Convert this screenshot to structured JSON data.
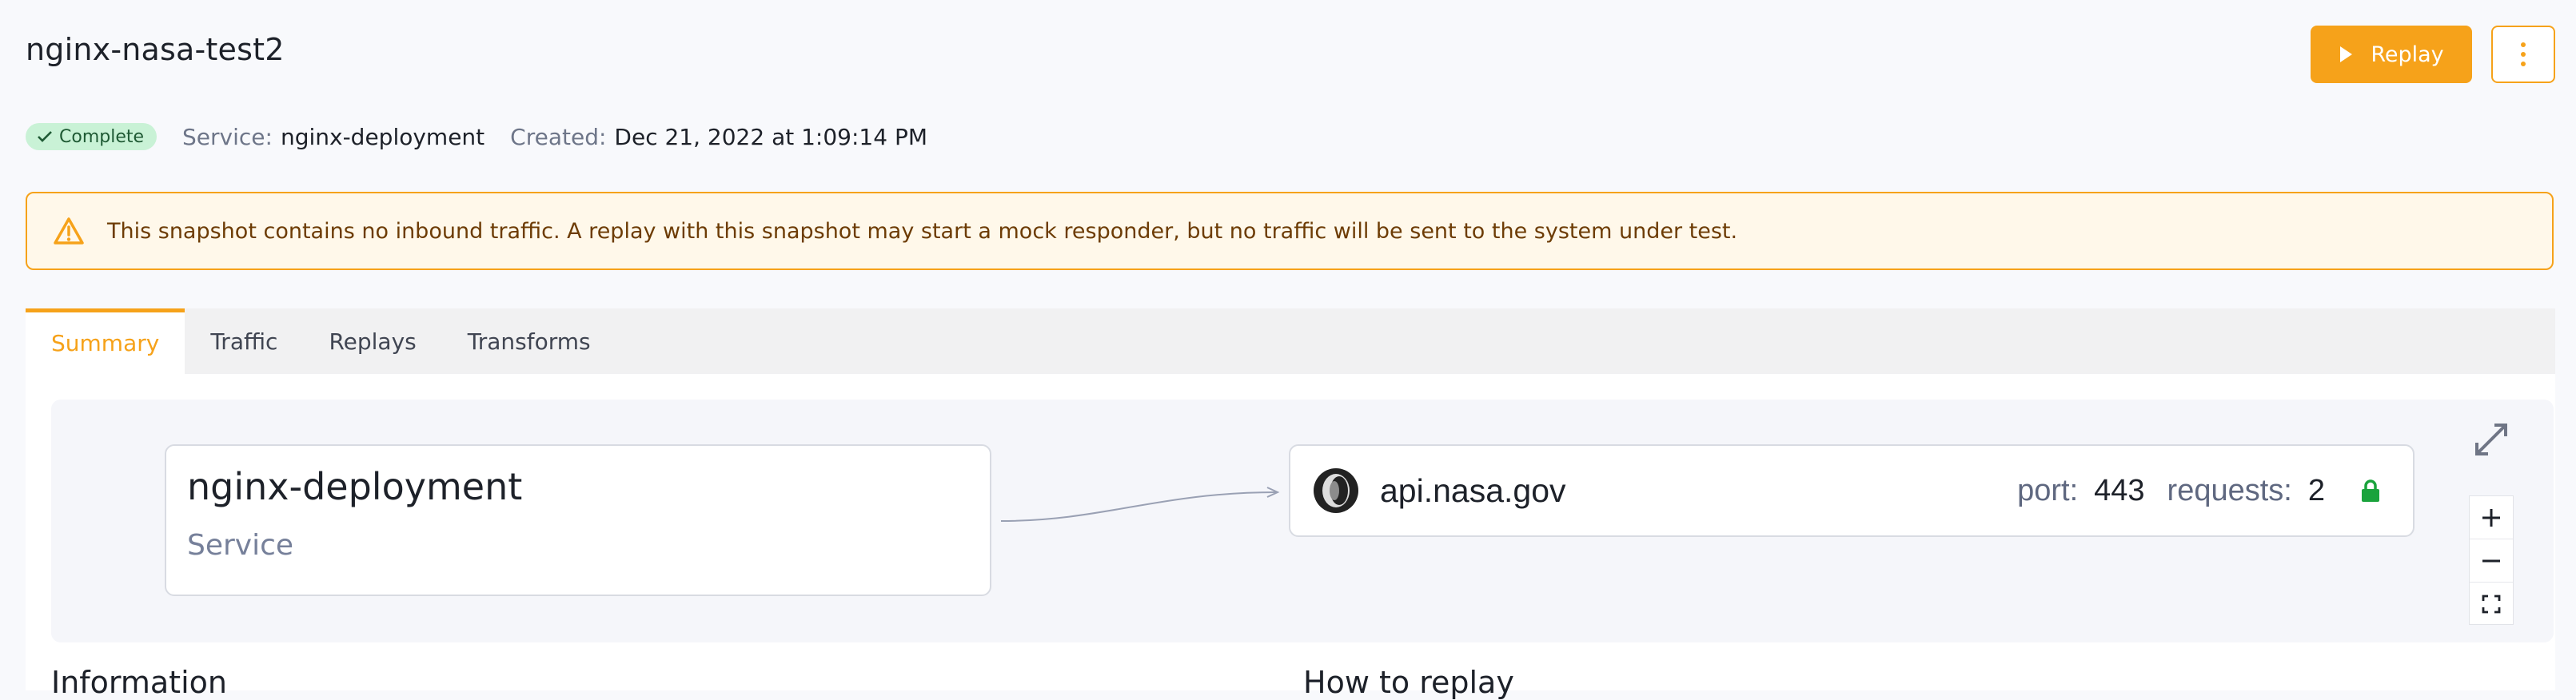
{
  "header": {
    "title": "nginx-nasa-test2",
    "replay_label": "Replay"
  },
  "meta": {
    "status": "Complete",
    "service_label": "Service:",
    "service_value": "nginx-deployment",
    "created_label": "Created:",
    "created_value": "Dec 21, 2022 at 1:09:14 PM"
  },
  "alert": {
    "text": "This snapshot contains no inbound traffic. A replay with this snapshot may start a mock responder, but no traffic will be sent to the system under test."
  },
  "tabs": [
    {
      "label": "Summary",
      "active": true
    },
    {
      "label": "Traffic"
    },
    {
      "label": "Replays"
    },
    {
      "label": "Transforms"
    }
  ],
  "graph": {
    "service_node": {
      "name": "nginx-deployment",
      "type": "Service"
    },
    "upstream_node": {
      "host": "api.nasa.gov",
      "port_label": "port:",
      "port": "443",
      "requests_label": "requests:",
      "requests": "2"
    }
  },
  "sections": {
    "information": "Information",
    "how_to_replay": "How to replay"
  },
  "colors": {
    "accent": "#f6a21a",
    "success_bg": "#c9f2d6",
    "lock": "#1aa33c"
  }
}
